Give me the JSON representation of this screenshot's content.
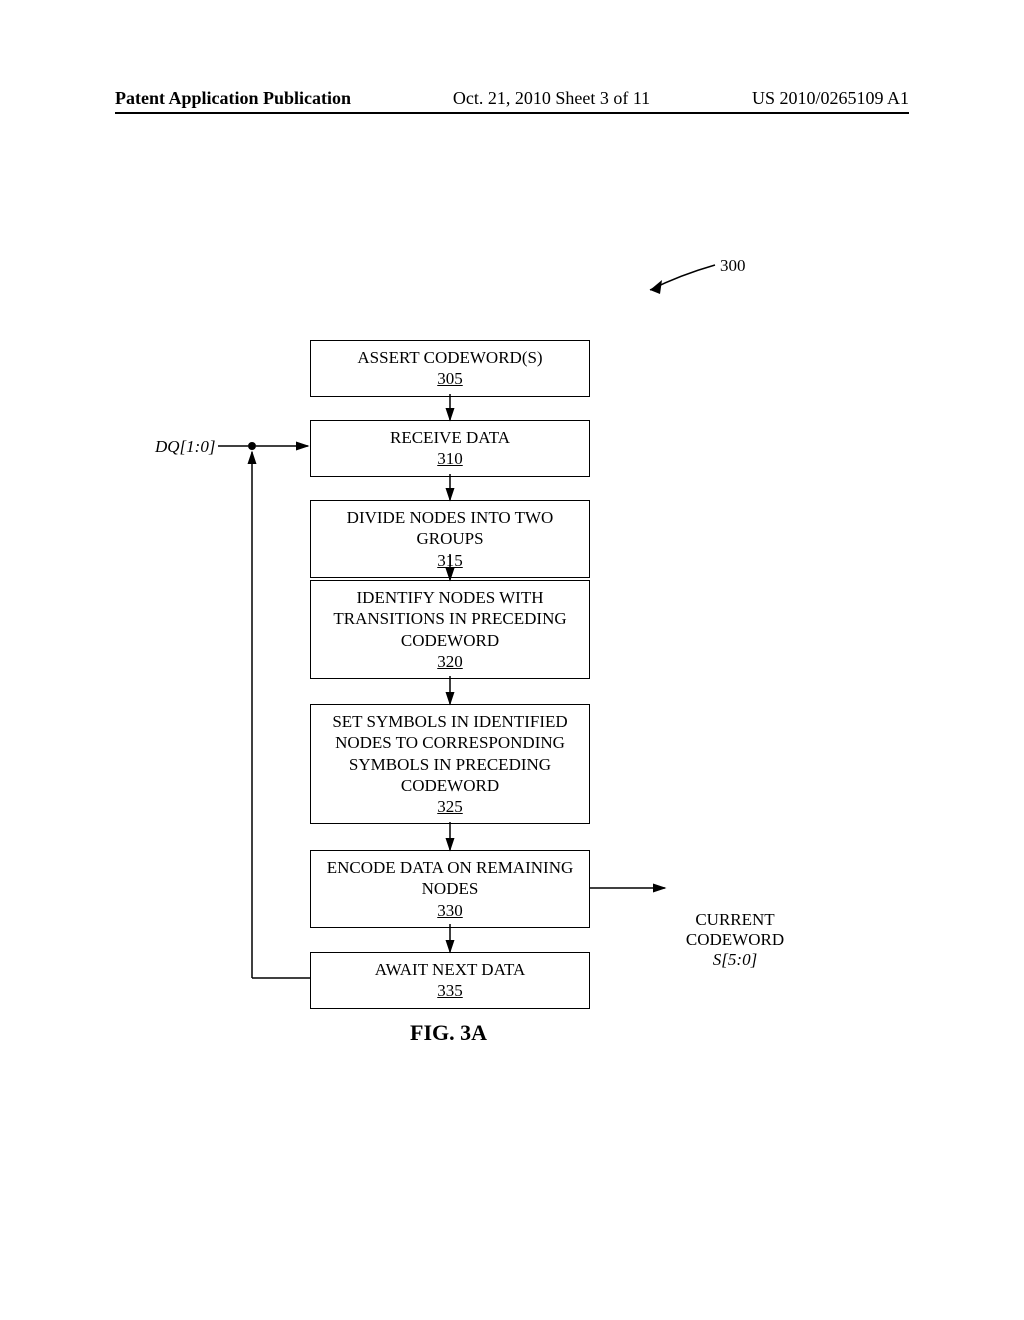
{
  "header": {
    "left": "Patent Application Publication",
    "mid": "Oct. 21, 2010  Sheet 3 of 11",
    "right": "US 2010/0265109 A1"
  },
  "ref300": "300",
  "dq_label": "DQ[1:0]",
  "output": {
    "line1": "CURRENT",
    "line2": "CODEWORD",
    "line3": "S[5:0]"
  },
  "boxes": {
    "b305": {
      "text": "ASSERT CODEWORD(S)",
      "ref": "305"
    },
    "b310": {
      "text": "RECEIVE DATA",
      "ref": "310"
    },
    "b315": {
      "text": "DIVIDE NODES INTO TWO GROUPS",
      "ref": "315"
    },
    "b320": {
      "line1": "IDENTIFY NODES WITH",
      "line2": "TRANSITIONS IN PRECEDING",
      "line3": "CODEWORD",
      "ref": "320"
    },
    "b325": {
      "line1": "SET SYMBOLS IN IDENTIFIED",
      "line2": "NODES TO CORRESPONDING",
      "line3": "SYMBOLS IN PRECEDING",
      "line4": "CODEWORD",
      "ref": "325"
    },
    "b330": {
      "line1": "ENCODE DATA ON REMAINING",
      "line2": "NODES",
      "ref": "330"
    },
    "b335": {
      "text": "AWAIT NEXT DATA",
      "ref": "335"
    }
  },
  "figcaption": "FIG. 3A",
  "chart_data": {
    "type": "flowchart",
    "title": "FIG. 3A",
    "reference": 300,
    "input": "DQ[1:0]",
    "output": "CURRENT CODEWORD S[5:0]",
    "nodes": [
      {
        "id": 305,
        "label": "ASSERT CODEWORD(S)"
      },
      {
        "id": 310,
        "label": "RECEIVE DATA"
      },
      {
        "id": 315,
        "label": "DIVIDE NODES INTO TWO GROUPS"
      },
      {
        "id": 320,
        "label": "IDENTIFY NODES WITH TRANSITIONS IN PRECEDING CODEWORD"
      },
      {
        "id": 325,
        "label": "SET SYMBOLS IN IDENTIFIED NODES TO CORRESPONDING SYMBOLS IN PRECEDING CODEWORD"
      },
      {
        "id": 330,
        "label": "ENCODE DATA ON REMAINING NODES"
      },
      {
        "id": 335,
        "label": "AWAIT NEXT DATA"
      }
    ],
    "edges": [
      {
        "from": 305,
        "to": 310
      },
      {
        "from": 310,
        "to": 315
      },
      {
        "from": 315,
        "to": 320
      },
      {
        "from": 320,
        "to": 325
      },
      {
        "from": 325,
        "to": 330
      },
      {
        "from": 330,
        "to": 335
      },
      {
        "from": 335,
        "to": 310,
        "type": "loop"
      },
      {
        "from": "DQ[1:0]",
        "to": 310,
        "type": "input"
      },
      {
        "from": 330,
        "to": "CURRENT CODEWORD S[5:0]",
        "type": "output"
      }
    ]
  }
}
